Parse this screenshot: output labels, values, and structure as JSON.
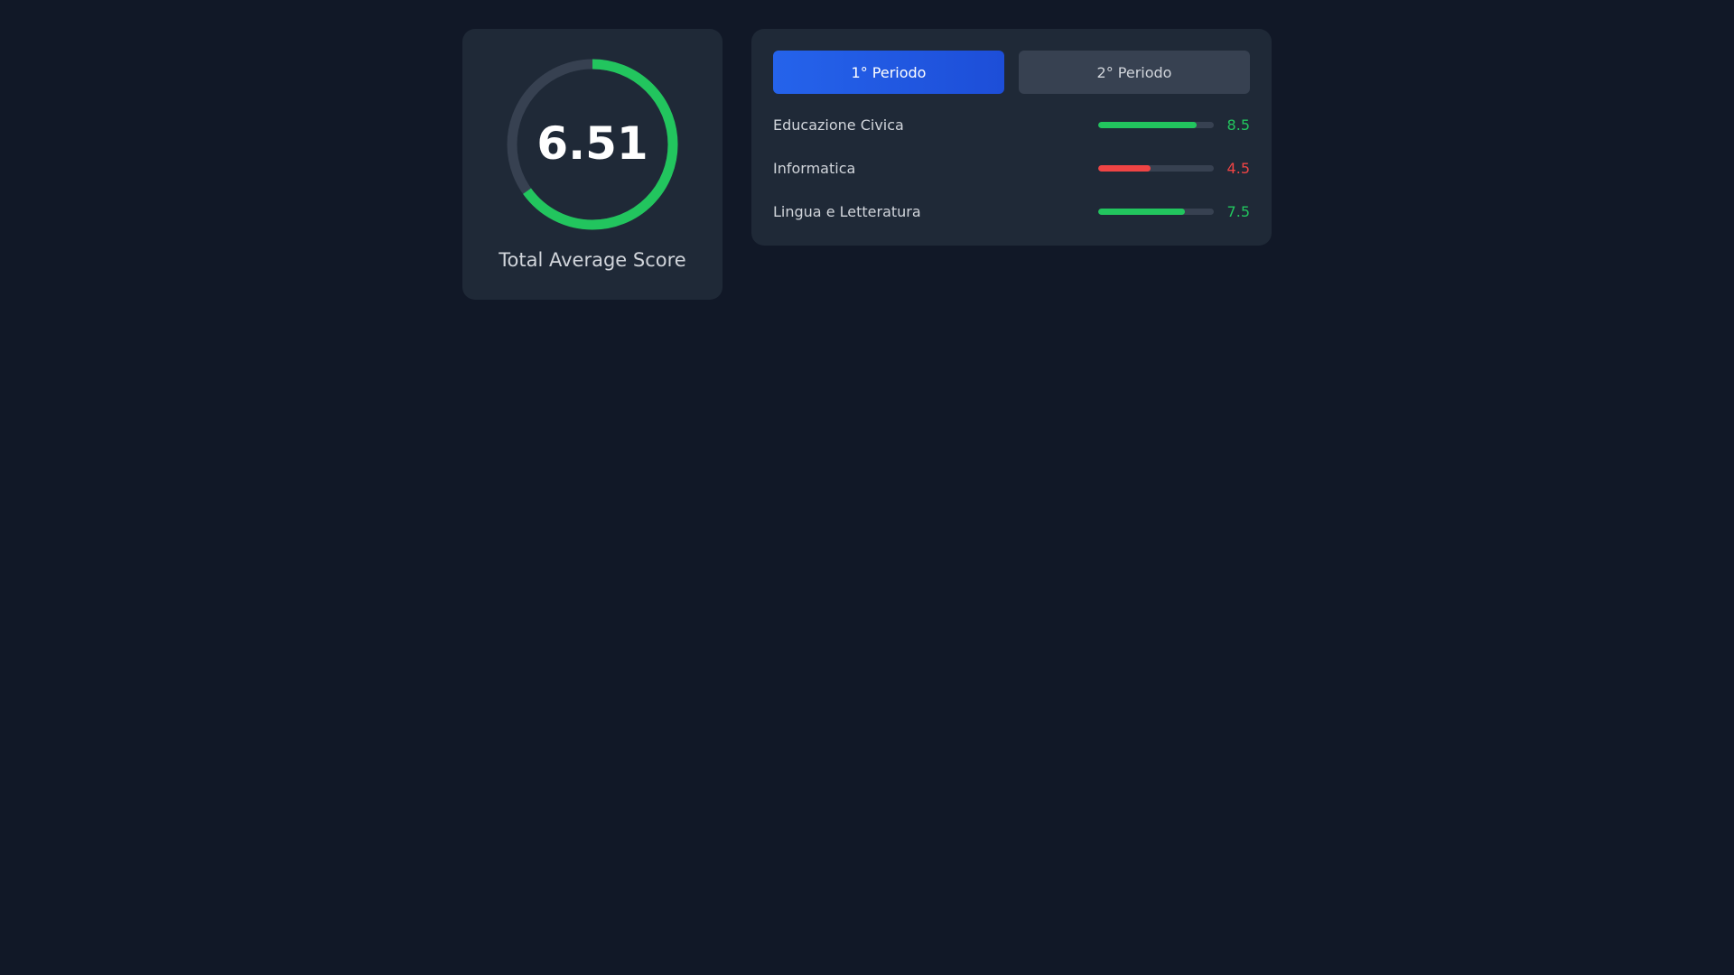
{
  "summary": {
    "average": "6.51",
    "average_value": 6.51,
    "max_value": 10,
    "label": "Total Average Score",
    "ring_color": "#22c55e",
    "ring_track_color": "#374151"
  },
  "tabs": [
    {
      "label": "1° Periodo",
      "active": true
    },
    {
      "label": "2° Periodo",
      "active": false
    }
  ],
  "subjects": [
    {
      "name": "Educazione Civica",
      "grade": "8.5",
      "value": 8.5,
      "color": "#22c55e"
    },
    {
      "name": "Informatica",
      "grade": "4.5",
      "value": 4.5,
      "color": "#ef4444"
    },
    {
      "name": "Lingua e Letteratura",
      "grade": "7.5",
      "value": 7.5,
      "color": "#22c55e"
    }
  ]
}
